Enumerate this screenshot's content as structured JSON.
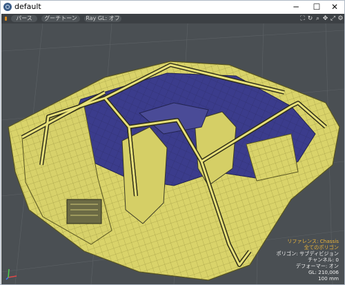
{
  "window": {
    "title": "default"
  },
  "window_controls": {
    "minimize": "─",
    "maximize": "☐",
    "close": "✕"
  },
  "toolbar": {
    "perspective": "パース",
    "shading": "グーチトーン",
    "raygl": "Ray GL: オフ"
  },
  "view_icons": [
    "maximize-view-icon",
    "reset-view-icon",
    "zoom-icon",
    "pan-icon",
    "rotate-icon",
    "options-icon"
  ],
  "view_icon_glyphs": {
    "maximize": "⛶",
    "reset": "↻",
    "zoom": "⌕",
    "pan": "✥",
    "rotate": "⤢",
    "options": "⚙"
  },
  "info": {
    "reference": "リファレンス: Chassis",
    "polygons_all": "全てのポリゴン",
    "polygon_type": "ポリゴン: サブディビジョン",
    "channel": "チャンネル: 0",
    "deformer": "デフォーマー: オン",
    "gl": "GL: 210,006",
    "scale": "100 mm"
  },
  "colors": {
    "viewport_bg": "#4a4f53",
    "mesh_fill": "#d9d36a",
    "mesh_interior": "#3b3c8c",
    "info_highlight": "#e8b23a"
  }
}
